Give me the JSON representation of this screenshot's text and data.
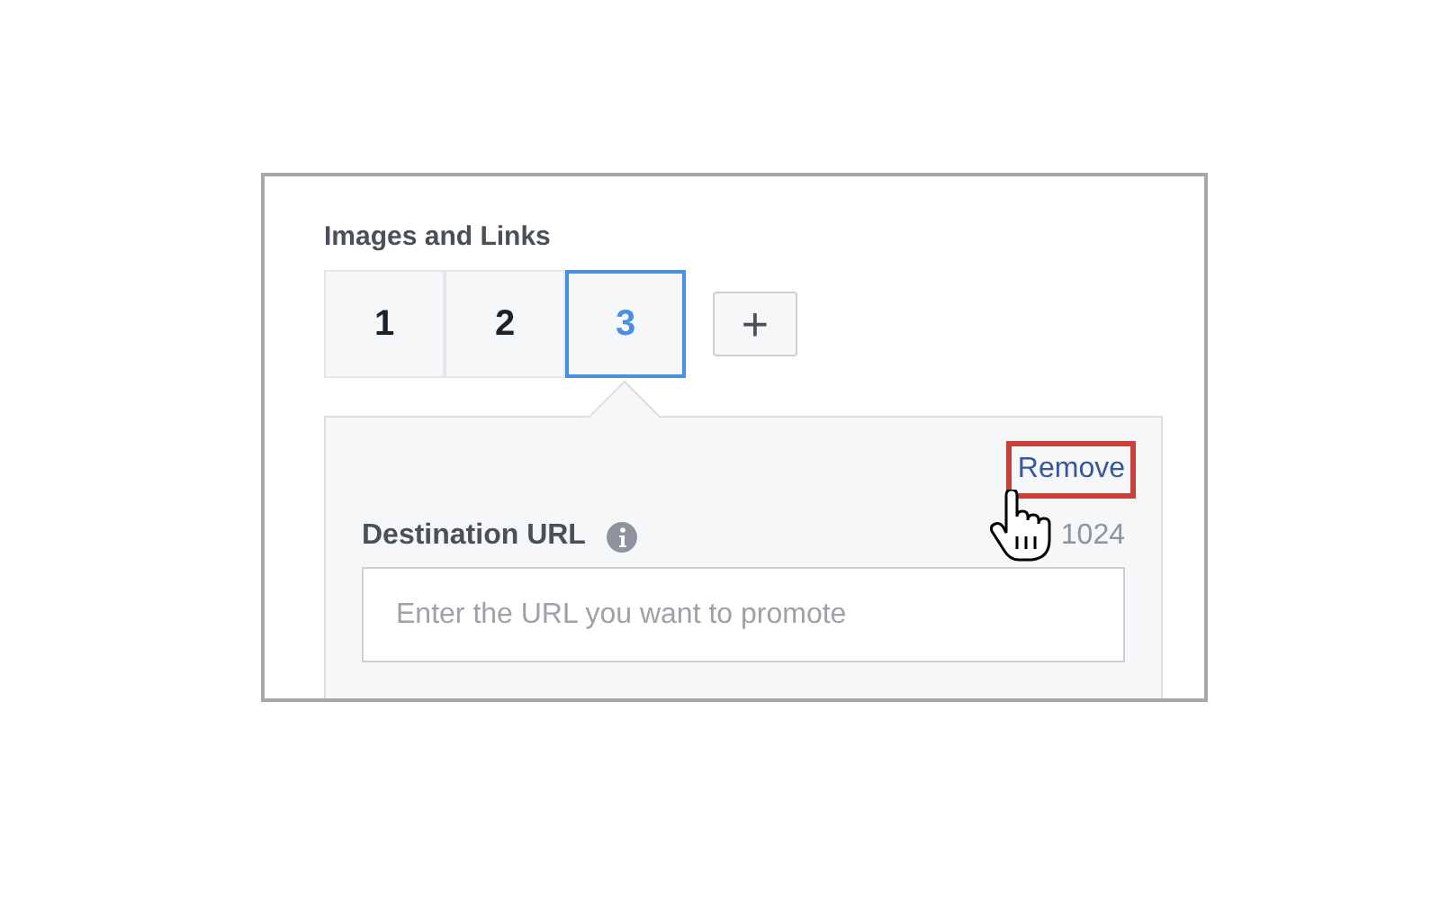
{
  "section": {
    "title": "Images and Links"
  },
  "tabs": [
    {
      "label": "1",
      "selected": false
    },
    {
      "label": "2",
      "selected": false
    },
    {
      "label": "3",
      "selected": true
    }
  ],
  "add_button": {
    "label": "+"
  },
  "panel": {
    "remove_link": {
      "label": "Remove",
      "highlighted": true
    },
    "field": {
      "label": "Destination URL",
      "counter": "1024",
      "placeholder": "Enter the URL you want to promote"
    }
  }
}
